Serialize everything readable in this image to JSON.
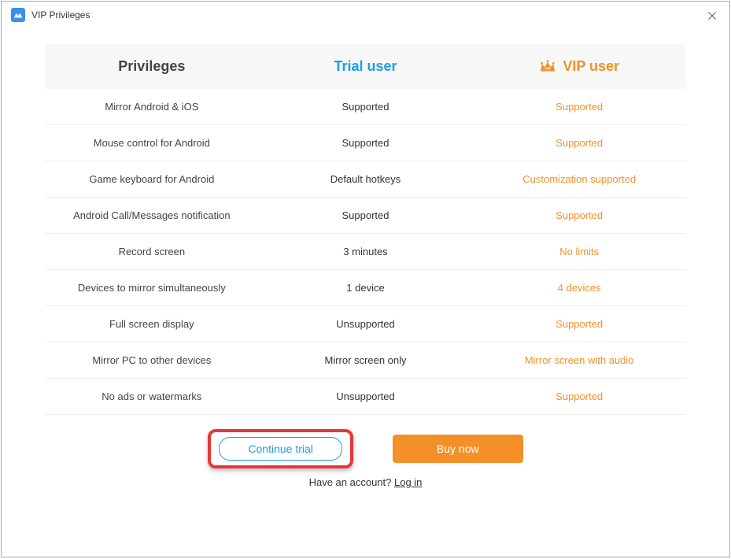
{
  "window": {
    "title": "VIP Privileges"
  },
  "header": {
    "privileges": "Privileges",
    "trial": "Trial user",
    "vip": "VIP user"
  },
  "rows": [
    {
      "name": "Mirror Android & iOS",
      "trial": "Supported",
      "vip": "Supported"
    },
    {
      "name": "Mouse control for Android",
      "trial": "Supported",
      "vip": "Supported"
    },
    {
      "name": "Game keyboard for Android",
      "trial": "Default hotkeys",
      "vip": "Customization supported"
    },
    {
      "name": "Android Call/Messages notification",
      "trial": "Supported",
      "vip": "Supported"
    },
    {
      "name": "Record screen",
      "trial": "3 minutes",
      "vip": "No limits"
    },
    {
      "name": "Devices to mirror simultaneously",
      "trial": "1 device",
      "vip": "4 devices"
    },
    {
      "name": "Full screen display",
      "trial": "Unsupported",
      "vip": "Supported"
    },
    {
      "name": "Mirror PC to other devices",
      "trial": "Mirror screen only",
      "vip": "Mirror screen with audio"
    },
    {
      "name": "No ads or watermarks",
      "trial": "Unsupported",
      "vip": "Supported"
    }
  ],
  "footer": {
    "continue_trial": "Continue trial",
    "buy_now": "Buy now",
    "have_account": "Have an account? ",
    "login": "Log in"
  }
}
